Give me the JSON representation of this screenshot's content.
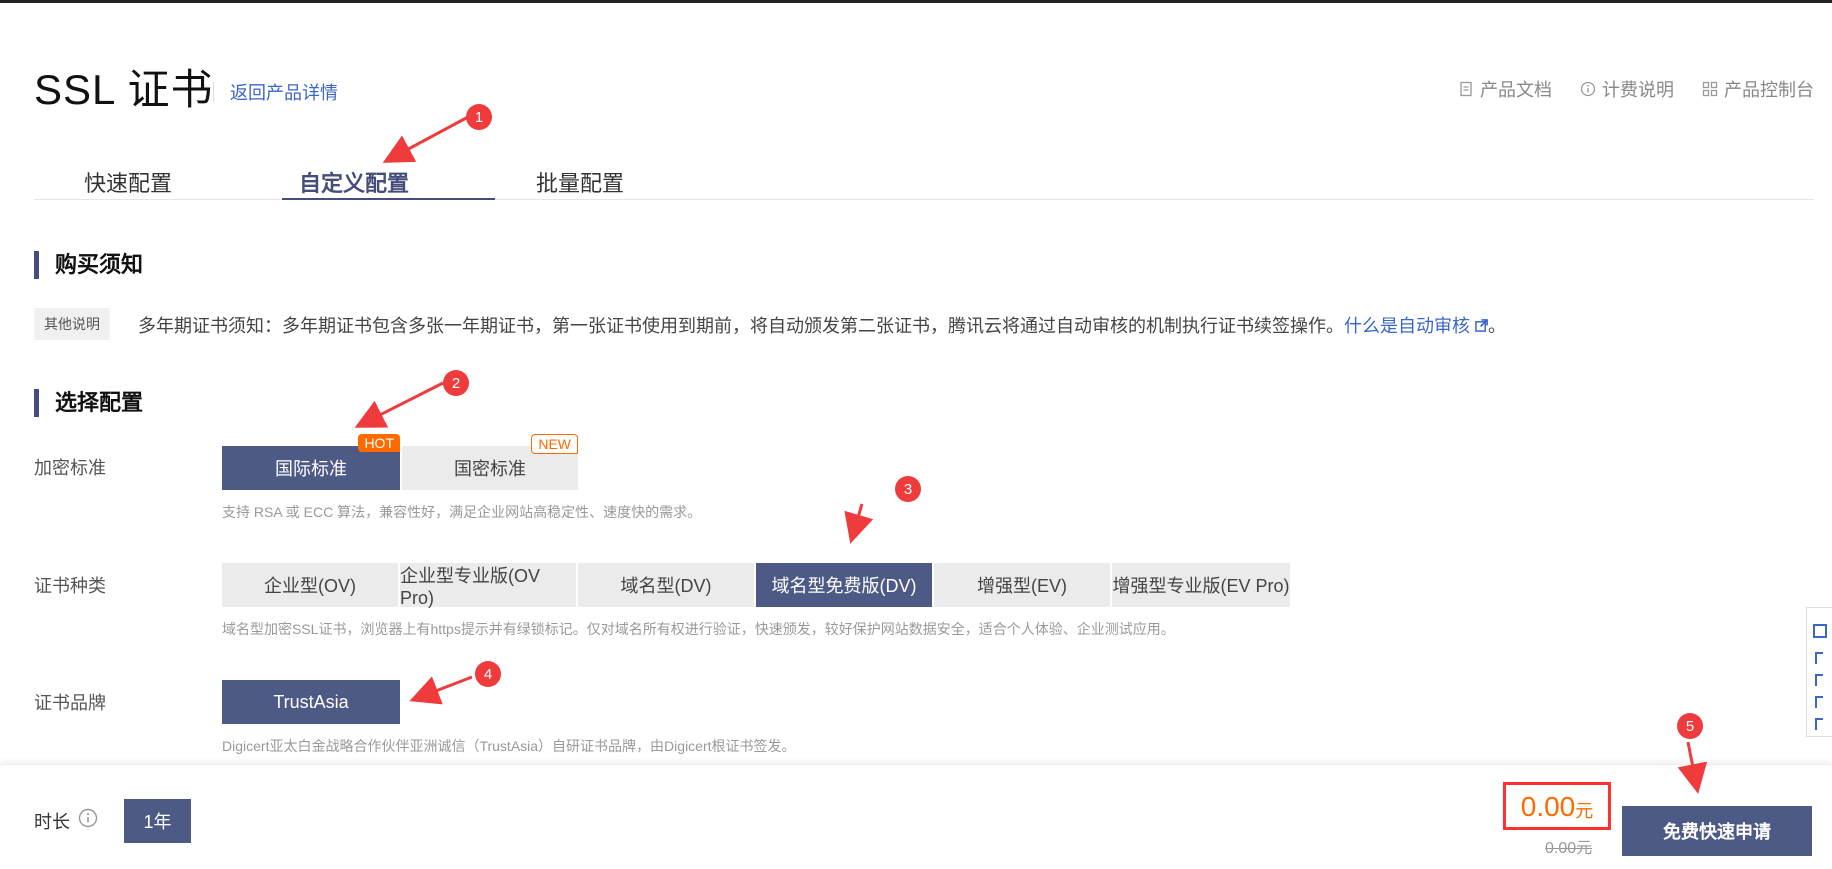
{
  "header": {
    "title": "SSL 证书",
    "back_link": "返回产品详情",
    "links": [
      {
        "icon": "document-icon",
        "label": "产品文档"
      },
      {
        "icon": "info-icon",
        "label": "计费说明"
      },
      {
        "icon": "grid-icon",
        "label": "产品控制台"
      }
    ]
  },
  "tabs": [
    {
      "label": "快速配置",
      "active": false
    },
    {
      "label": "自定义配置",
      "active": true
    },
    {
      "label": "批量配置",
      "active": false
    }
  ],
  "purchase_notice": {
    "heading": "购买须知",
    "badge": "其他说明",
    "text": "多年期证书须知：多年期证书包含多张一年期证书，第一张证书使用到期前，将自动颁发第二张证书，腾讯云将通过自动审核的机制执行证书续签操作。",
    "link": "什么是自动审核",
    "end": "。"
  },
  "config": {
    "heading": "选择配置",
    "encryption": {
      "label": "加密标准",
      "options": [
        {
          "label": "国际标准",
          "tag": "HOT",
          "selected": true
        },
        {
          "label": "国密标准",
          "tag": "NEW",
          "selected": false
        }
      ],
      "hint": "支持 RSA 或 ECC 算法，兼容性好，满足企业网站高稳定性、速度快的需求。"
    },
    "cert_type": {
      "label": "证书种类",
      "options": [
        {
          "label": "企业型(OV)",
          "selected": false
        },
        {
          "label": "企业型专业版(OV Pro)",
          "selected": false
        },
        {
          "label": "域名型(DV)",
          "selected": false
        },
        {
          "label": "域名型免费版(DV)",
          "selected": true
        },
        {
          "label": "增强型(EV)",
          "selected": false
        },
        {
          "label": "增强型专业版(EV Pro)",
          "selected": false
        }
      ],
      "hint": "域名型加密SSL证书，浏览器上有https提示并有绿锁标记。仅对域名所有权进行验证，快速颁发，较好保护网站数据安全，适合个人体验、企业测试应用。"
    },
    "brand": {
      "label": "证书品牌",
      "options": [
        {
          "label": "TrustAsia",
          "selected": true
        }
      ],
      "hint": "Digicert亚太白金战略合作伙伴亚洲诚信（TrustAsia）自研证书品牌，由Digicert根证书签发。"
    }
  },
  "bottom": {
    "duration_label": "时长",
    "duration_option": "1年",
    "price": "0.00",
    "price_unit": "元",
    "original_price": "0.00元",
    "apply_button": "免费快速申请"
  },
  "annotations": [
    "1",
    "2",
    "3",
    "4",
    "5"
  ],
  "colors": {
    "primary": "#4e5a86",
    "link": "#3a66c8",
    "accent": "#ff6a00",
    "annotation": "#ef3b3b"
  }
}
